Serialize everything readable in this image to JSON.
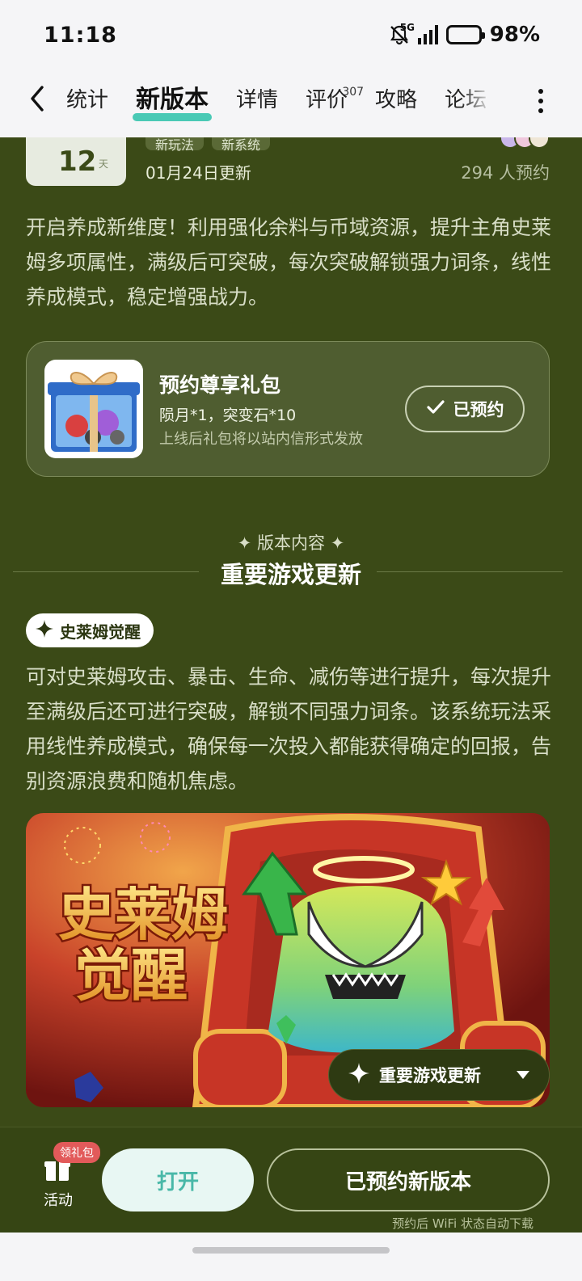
{
  "status": {
    "time": "11:18",
    "battery": "98%",
    "network": "5G",
    "battery_level": 0.98
  },
  "nav": {
    "tabs": [
      {
        "label": "统计"
      },
      {
        "label": "新版本",
        "active": true
      },
      {
        "label": "详情"
      },
      {
        "label": "评价",
        "count": "307"
      },
      {
        "label": "攻略"
      },
      {
        "label": "论坛"
      }
    ]
  },
  "header": {
    "countdown": "12",
    "countdown_unit": "天",
    "tags": [
      "新玩法",
      "新系统"
    ],
    "updated": "01月24日更新",
    "reservations": "294 人预约"
  },
  "intro": "开启养成新维度！利用强化余料与币域资源，提升主角史莱姆多项属性，满级后可突破，每次突破解锁强力词条，线性养成模式，稳定增强战力。",
  "gift": {
    "title": "预约尊享礼包",
    "items": "陨月*1，突变石*10",
    "note": "上线后礼包将以站内信形式发放",
    "button": "已预约"
  },
  "section": {
    "subtitle": "版本内容",
    "title": "重要游戏更新",
    "feature_tag": "史莱姆觉醒",
    "feature_desc": "可对史莱姆攻击、暴击、生命、减伤等进行提升，每次提升至满级后还可进行突破，解锁不同强力词条。该系统玩法采用线性养成模式，确保每一次投入都能获得确定的回报，告别资源浪费和随机焦虑。"
  },
  "banner": {
    "title_line1": "史莱姆",
    "title_line2": "觉醒",
    "float_label": "重要游戏更新"
  },
  "bottom": {
    "activity_label": "活动",
    "activity_badge": "领礼包",
    "open": "打开",
    "reserved": "已预约新版本",
    "note": "预约后 WiFi 状态自动下载"
  },
  "colors": {
    "page_bg": "#3b4a17",
    "accent": "#49c9b5",
    "topbar_bg": "#f5f5f7"
  }
}
